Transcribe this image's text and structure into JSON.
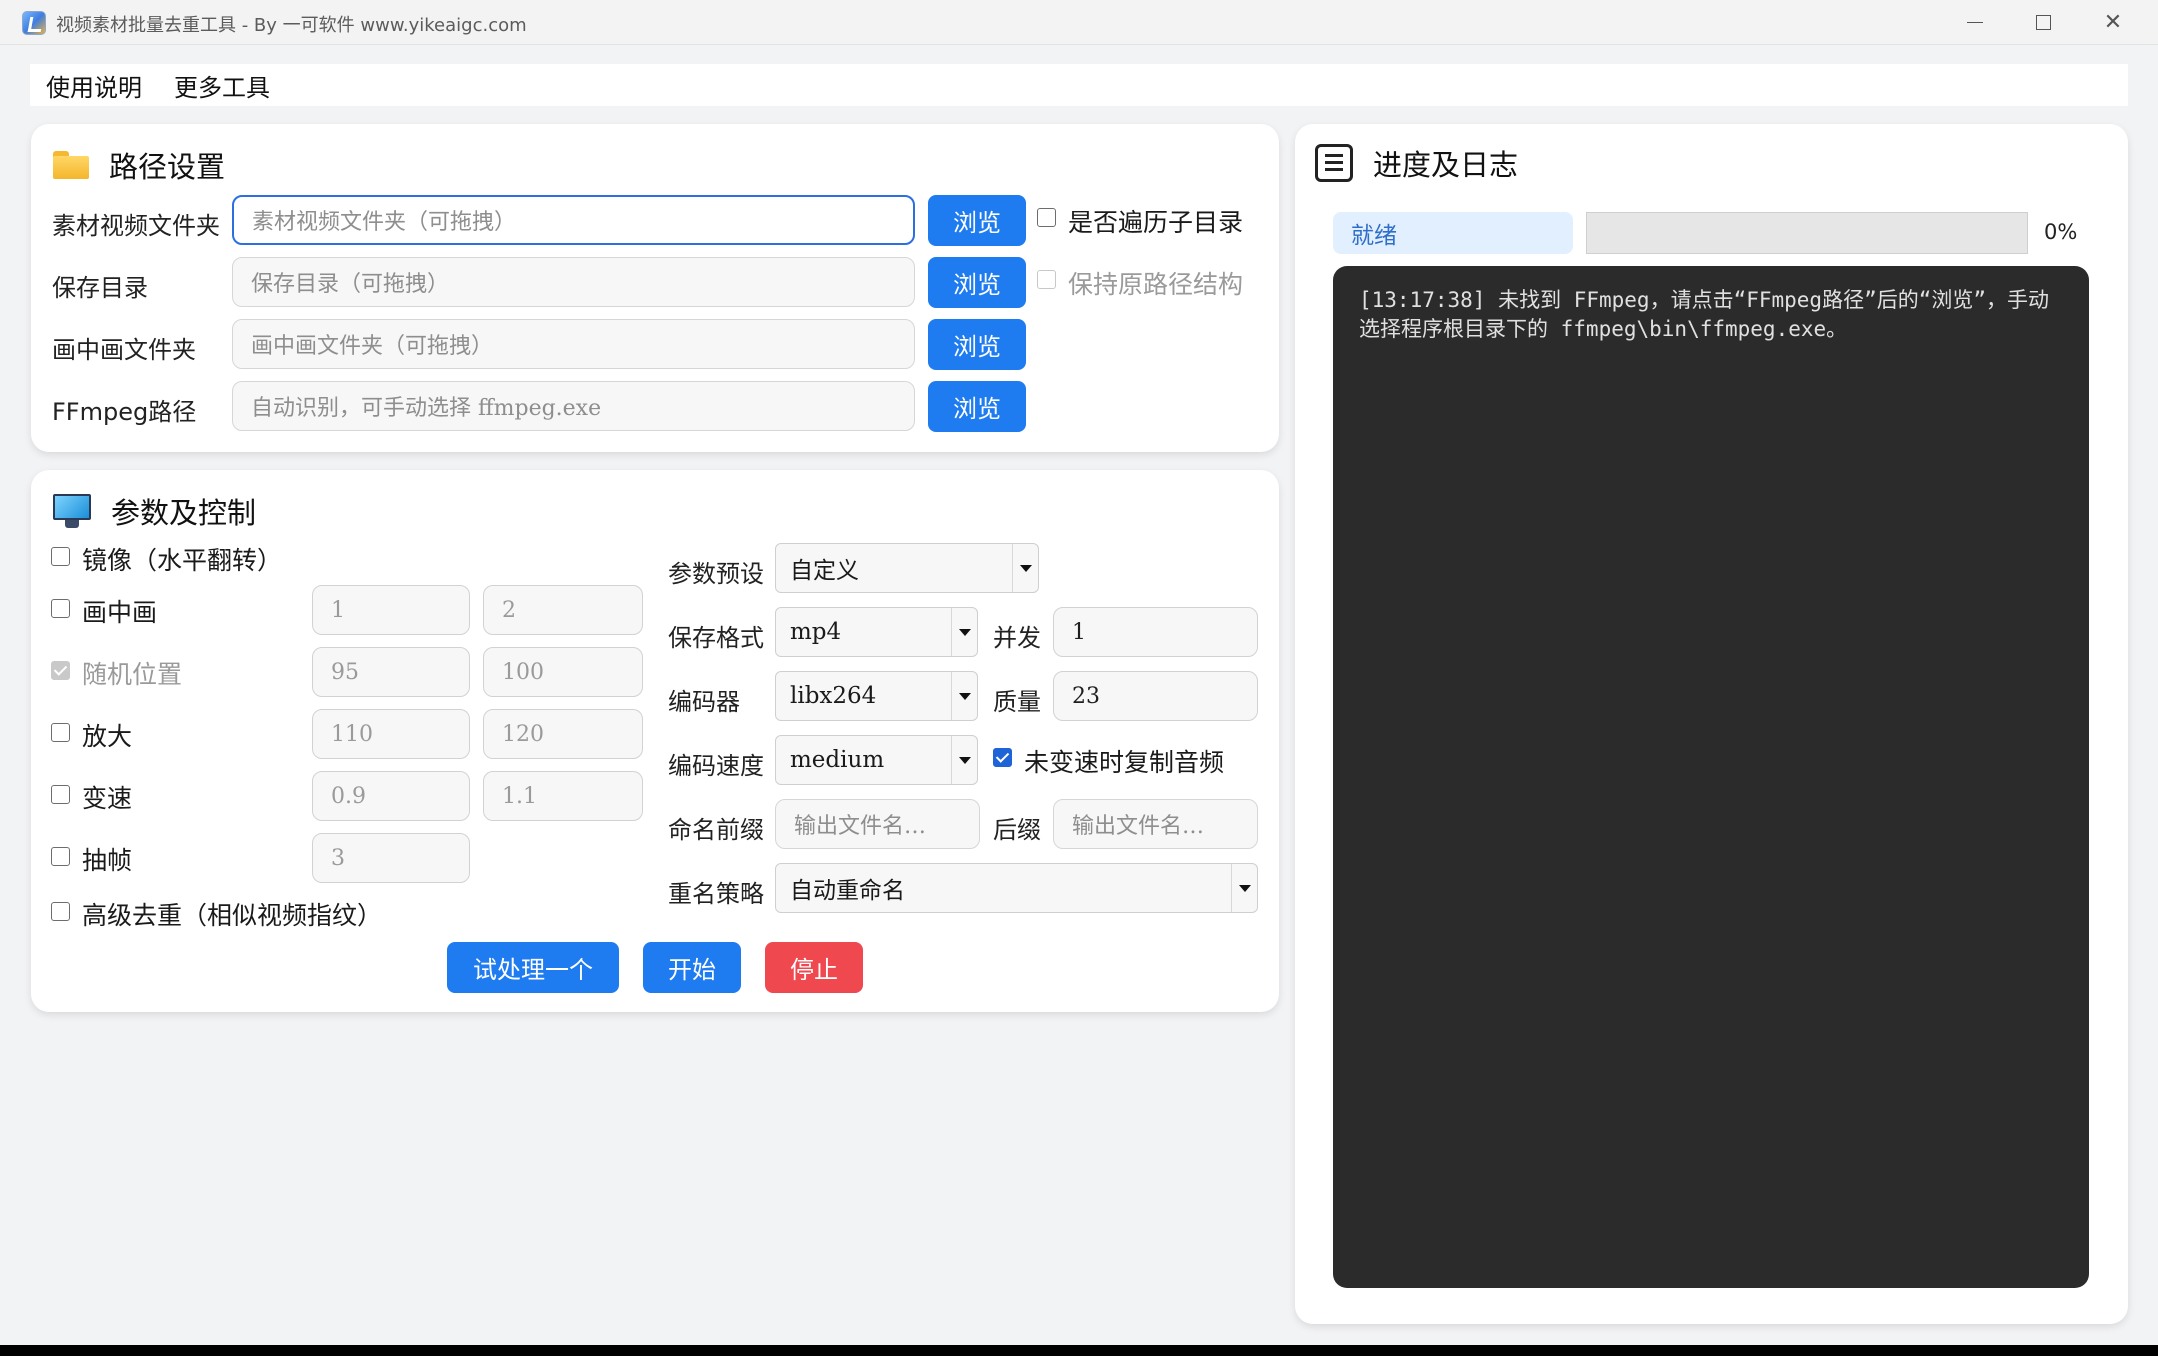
{
  "window": {
    "title": "视频素材批量去重工具 - By 一可软件 www.yikeaigc.com"
  },
  "menu": {
    "items": [
      "使用说明",
      "更多工具"
    ]
  },
  "path_settings": {
    "title": "路径设置",
    "rows": [
      {
        "label": "素材视频文件夹",
        "placeholder": "素材视频文件夹（可拖拽）",
        "button": "浏览"
      },
      {
        "label": "保存目录",
        "placeholder": "保存目录（可拖拽）",
        "button": "浏览"
      },
      {
        "label": "画中画文件夹",
        "placeholder": "画中画文件夹（可拖拽）",
        "button": "浏览"
      },
      {
        "label": "FFmpeg路径",
        "placeholder": "自动识别，可手动选择 ffmpeg.exe",
        "button": "浏览"
      }
    ],
    "recurse_label": "是否遍历子目录",
    "recurse_checked": false,
    "keep_structure_label": "保持原路径结构",
    "keep_structure_checked": false
  },
  "params": {
    "title": "参数及控制",
    "options": [
      {
        "label": "镜像（水平翻转）",
        "checked": false
      },
      {
        "label": "画中画",
        "checked": false,
        "v1": "1",
        "v2": "2"
      },
      {
        "label": "随机位置",
        "checked": true,
        "disabled": true,
        "v1": "95",
        "v2": "100"
      },
      {
        "label": "放大",
        "checked": false,
        "v1": "110",
        "v2": "120"
      },
      {
        "label": "变速",
        "checked": false,
        "v1": "0.9",
        "v2": "1.1"
      },
      {
        "label": "抽帧",
        "checked": false,
        "v1": "3"
      },
      {
        "label": "高级去重（相似视频指纹）",
        "checked": false
      }
    ],
    "preset_label": "参数预设",
    "preset_value": "自定义",
    "format_label": "保存格式",
    "format_value": "mp4",
    "concurrency_label": "并发",
    "concurrency_value": "1",
    "encoder_label": "编码器",
    "encoder_value": "libx264",
    "quality_label": "质量",
    "quality_value": "23",
    "speed_label": "编码速度",
    "speed_value": "medium",
    "copy_audio_label": "未变速时复制音频",
    "copy_audio_checked": true,
    "prefix_label": "命名前缀",
    "prefix_placeholder": "输出文件名…",
    "suffix_label": "后缀",
    "suffix_placeholder": "输出文件名…",
    "rename_label": "重名策略",
    "rename_value": "自动重命名",
    "buttons": {
      "trial": "试处理一个",
      "start": "开始",
      "stop": "停止"
    }
  },
  "progress": {
    "title": "进度及日志",
    "status": "就绪",
    "percent": 0,
    "percent_label": "0%",
    "log": "[13:17:38] 未找到 FFmpeg，请点击“FFmpeg路径”后的“浏览”，手动选择程序根目录下的 ffmpeg\\bin\\ffmpeg.exe。"
  },
  "colors": {
    "accent": "#1f7bf0",
    "danger": "#f0484f",
    "log_bg": "#2b2b2b"
  }
}
